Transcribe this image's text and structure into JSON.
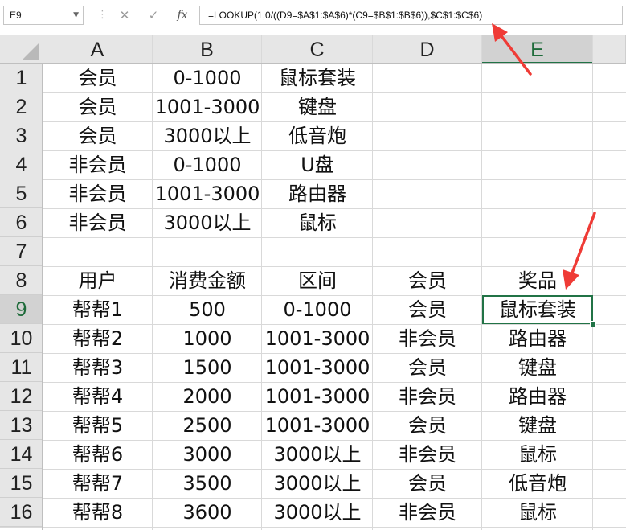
{
  "formula_bar": {
    "name_box": "E9",
    "formula": "=LOOKUP(1,0/((D9=$A$1:$A$6)*(C9=$B$1:$B$6)),$C$1:$C$6)",
    "separator": "⋮",
    "cancel_glyph": "✕",
    "enter_glyph": "✓",
    "fx_glyph": "fx"
  },
  "columns": [
    "A",
    "B",
    "C",
    "D",
    "E"
  ],
  "selected_column": "E",
  "selected_row": "9",
  "rows": [
    {
      "num": "1",
      "cells": [
        "会员",
        "0-1000",
        "鼠标套装",
        "",
        ""
      ]
    },
    {
      "num": "2",
      "cells": [
        "会员",
        "1001-3000",
        "键盘",
        "",
        ""
      ]
    },
    {
      "num": "3",
      "cells": [
        "会员",
        "3000以上",
        "低音炮",
        "",
        ""
      ]
    },
    {
      "num": "4",
      "cells": [
        "非会员",
        "0-1000",
        "U盘",
        "",
        ""
      ]
    },
    {
      "num": "5",
      "cells": [
        "非会员",
        "1001-3000",
        "路由器",
        "",
        ""
      ]
    },
    {
      "num": "6",
      "cells": [
        "非会员",
        "3000以上",
        "鼠标",
        "",
        ""
      ]
    },
    {
      "num": "7",
      "cells": [
        "",
        "",
        "",
        "",
        ""
      ]
    },
    {
      "num": "8",
      "cells": [
        "用户",
        "消费金额",
        "区间",
        "会员",
        "奖品"
      ]
    },
    {
      "num": "9",
      "cells": [
        "帮帮1",
        "500",
        "0-1000",
        "会员",
        "鼠标套装"
      ]
    },
    {
      "num": "10",
      "cells": [
        "帮帮2",
        "1000",
        "1001-3000",
        "非会员",
        "路由器"
      ]
    },
    {
      "num": "11",
      "cells": [
        "帮帮3",
        "1500",
        "1001-3000",
        "会员",
        "键盘"
      ]
    },
    {
      "num": "12",
      "cells": [
        "帮帮4",
        "2000",
        "1001-3000",
        "非会员",
        "路由器"
      ]
    },
    {
      "num": "13",
      "cells": [
        "帮帮5",
        "2500",
        "1001-3000",
        "会员",
        "键盘"
      ]
    },
    {
      "num": "14",
      "cells": [
        "帮帮6",
        "3000",
        "3000以上",
        "非会员",
        "鼠标"
      ]
    },
    {
      "num": "15",
      "cells": [
        "帮帮7",
        "3500",
        "3000以上",
        "会员",
        "低音炮"
      ]
    },
    {
      "num": "16",
      "cells": [
        "帮帮8",
        "3600",
        "3000以上",
        "非会员",
        "鼠标"
      ]
    }
  ],
  "colors": {
    "selection": "#217346",
    "annotation_arrow": "#ef3b36",
    "header_bg": "#e6e6e6",
    "gridline": "#d9d9d9"
  }
}
